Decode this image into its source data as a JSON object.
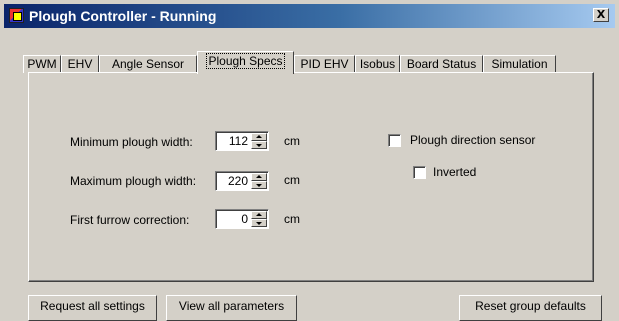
{
  "window": {
    "title": "Plough Controller - Running",
    "close_label": "X"
  },
  "tabs": [
    {
      "label": "PWM",
      "active": false
    },
    {
      "label": "EHV",
      "active": false
    },
    {
      "label": "Angle Sensor",
      "active": false
    },
    {
      "label": "Plough Specs",
      "active": true
    },
    {
      "label": "PID EHV",
      "active": false
    },
    {
      "label": "Isobus",
      "active": false
    },
    {
      "label": "Board Status",
      "active": false
    },
    {
      "label": "Simulation",
      "active": false
    }
  ],
  "plough_specs": {
    "min_width": {
      "label": "Minimum plough width:",
      "value": "112",
      "unit": "cm"
    },
    "max_width": {
      "label": "Maximum plough width:",
      "value": "220",
      "unit": "cm"
    },
    "furrow_correction": {
      "label": "First furrow correction:",
      "value": "0",
      "unit": "cm"
    },
    "direction_sensor": {
      "label": "Plough direction sensor",
      "checked": false
    },
    "inverted": {
      "label": "Inverted",
      "checked": false
    }
  },
  "buttons": {
    "request_all": "Request all settings",
    "view_all": "View all parameters",
    "reset_group": "Reset group defaults"
  },
  "icons": {
    "app": "app-icon",
    "close": "close-icon",
    "spin_up": "spin-up-arrow-icon",
    "spin_down": "spin-down-arrow-icon"
  },
  "colors": {
    "title_gradient_start": "#0a246a",
    "title_gradient_end": "#a6caf0",
    "face": "#d4d0c8"
  }
}
